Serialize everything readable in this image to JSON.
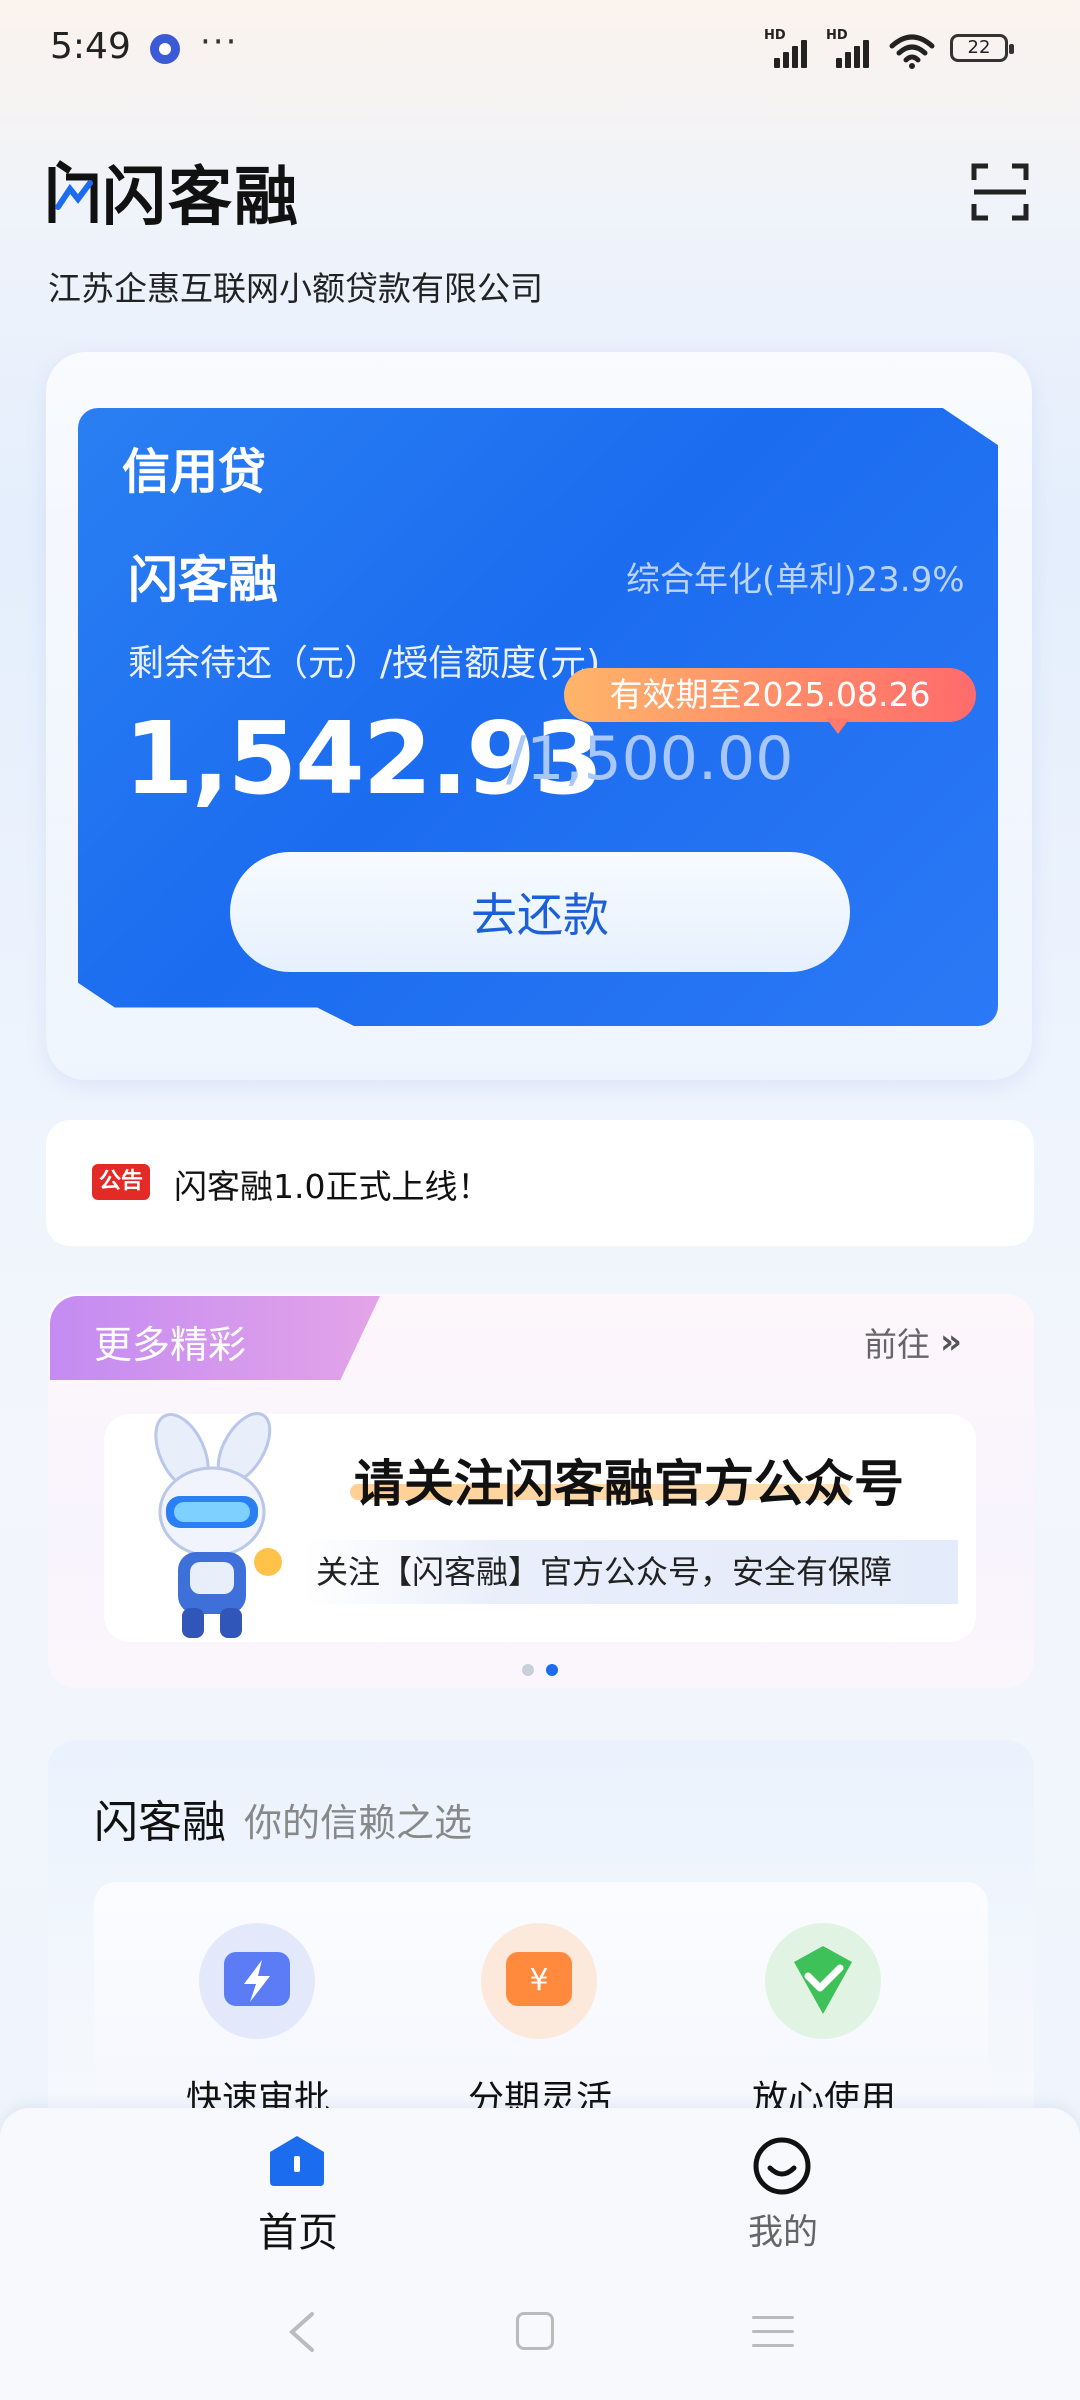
{
  "status_bar": {
    "time": "5:49",
    "more": "···",
    "hd1": "HD",
    "hd2": "HD",
    "battery": "22"
  },
  "header": {
    "app_name": "闪客融",
    "company": "江苏企惠互联网小额贷款有限公司"
  },
  "credit_card": {
    "tag": "信用贷",
    "product": "闪客融",
    "rate": "综合年化(单利)23.9%",
    "remain_label": "剩余待还（元）/授信额度(元)",
    "expiry": "有效期至2025.08.26",
    "amount": "1,542.93",
    "limit": "/1,500.00",
    "repay_button": "去还款"
  },
  "notice": {
    "badge": "公告",
    "text": "闪客融1.0正式上线！"
  },
  "more": {
    "title": "更多精彩",
    "goto": "前往",
    "banner_title": "请关注闪客融官方公众号",
    "banner_sub": "关注【闪客融】官方公众号，安全有保障",
    "active_page": 2,
    "page_count": 2
  },
  "trust": {
    "brand": "闪客融",
    "slogan": "你的信赖之选",
    "features": [
      {
        "label": "快速审批",
        "icon": "lightning-icon"
      },
      {
        "label": "分期灵活",
        "icon": "yuan-icon"
      },
      {
        "label": "放心使用",
        "icon": "check-shield-icon"
      }
    ]
  },
  "nav": {
    "home": "首页",
    "me": "我的"
  },
  "colors": {
    "primary": "#1c6cf0",
    "notice_red": "#e32a26",
    "expiry_orange": "#ff8b6a"
  }
}
